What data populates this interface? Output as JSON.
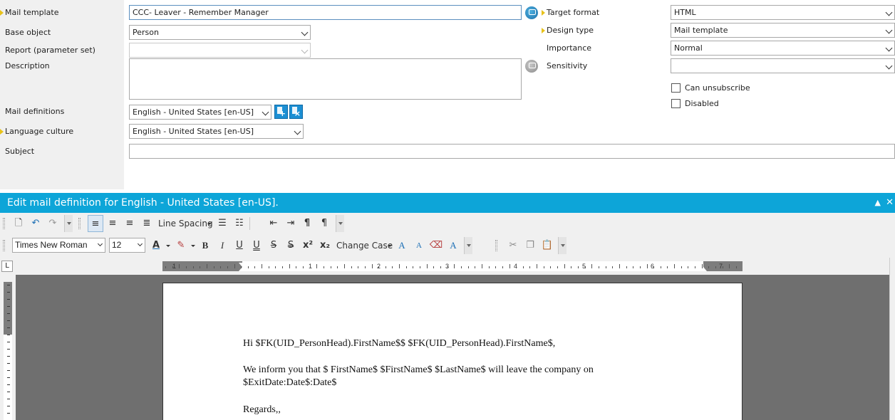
{
  "form": {
    "mail_template_label": "Mail template",
    "mail_template_value": "CCC- Leaver - Remember Manager",
    "base_object_label": "Base object",
    "base_object_value": "Person",
    "report_label": "Report (parameter set)",
    "report_value": "",
    "description_label": "Description",
    "description_value": "",
    "mail_definitions_label": "Mail definitions",
    "mail_definitions_value": "English - United States [en-US]",
    "language_culture_label": "Language culture",
    "language_culture_value": "English - United States [en-US]",
    "subject_label": "Subject",
    "subject_value": "",
    "target_format_label": "Target format",
    "target_format_value": "HTML",
    "design_type_label": "Design type",
    "design_type_value": "Mail template",
    "importance_label": "Importance",
    "importance_value": "Normal",
    "sensitivity_label": "Sensitivity",
    "sensitivity_value": "",
    "can_unsubscribe_label": "Can unsubscribe",
    "disabled_label": "Disabled"
  },
  "editor": {
    "header_title": "Edit mail definition for English - United States [en-US].",
    "line_spacing_label": "Line Spacing",
    "change_case_label": "Change Case",
    "font_name": "Times New Roman",
    "font_size": "12",
    "ruler_numbers": [
      "1",
      "1",
      "2",
      "3",
      "4",
      "5",
      "6",
      "7"
    ]
  },
  "document": {
    "line1": "Hi $FK(UID_PersonHead).FirstName$$ $FK(UID_PersonHead).FirstName$,",
    "line2": "We inform you that  $ FirstName$   $FirstName$ $LastName$ will leave the company on",
    "line3": "$ExitDate:Date$:Date$",
    "line4": "Regards,,"
  },
  "colors": {
    "header_bg": "#0da5d8",
    "required_marker": "#e8c21a",
    "label_column_bg": "#f0f0f0",
    "doc_background": "#6f6f6f"
  },
  "icons": [
    "new-document-icon",
    "undo-icon",
    "redo-icon",
    "align-left-icon",
    "align-center-icon",
    "align-right-icon",
    "justify-icon",
    "bullets-icon",
    "numbering-icon",
    "outdent-icon",
    "indent-icon",
    "pilcrow-icon",
    "font-color-icon",
    "highlight-icon",
    "bold-icon",
    "italic-icon",
    "underline-icon",
    "double-underline-icon",
    "strikethrough-icon",
    "superscript-icon",
    "subscript-icon",
    "grow-font-icon",
    "shrink-font-icon",
    "clear-format-icon",
    "cut-icon",
    "copy-icon",
    "paste-icon",
    "globe-icon"
  ]
}
